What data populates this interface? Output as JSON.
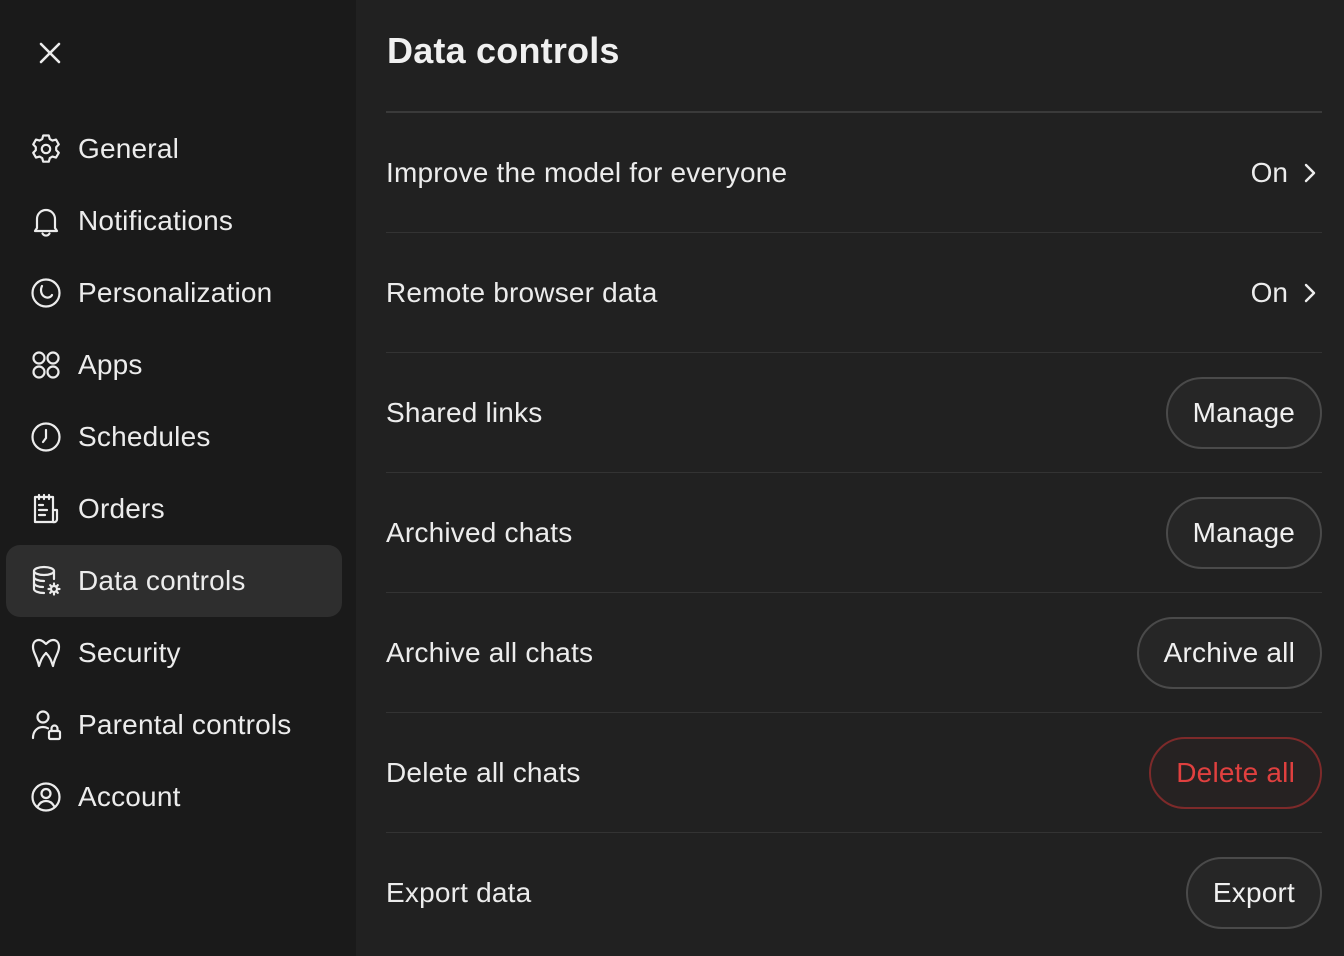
{
  "sidebar": {
    "close_icon": "close-icon",
    "items": [
      {
        "label": "General",
        "icon": "gear-icon"
      },
      {
        "label": "Notifications",
        "icon": "bell-icon"
      },
      {
        "label": "Personalization",
        "icon": "personalization-icon"
      },
      {
        "label": "Apps",
        "icon": "apps-grid-icon"
      },
      {
        "label": "Schedules",
        "icon": "clock-icon"
      },
      {
        "label": "Orders",
        "icon": "receipt-icon"
      },
      {
        "label": "Data controls",
        "icon": "database-gear-icon",
        "active": true
      },
      {
        "label": "Security",
        "icon": "shield-key-icon"
      },
      {
        "label": "Parental controls",
        "icon": "person-lock-icon"
      },
      {
        "label": "Account",
        "icon": "user-circle-icon"
      }
    ]
  },
  "main": {
    "title": "Data controls",
    "rows": [
      {
        "label": "Improve the model for everyone",
        "value": "On",
        "icon": "chevron-right-icon"
      },
      {
        "label": "Remote browser data",
        "value": "On",
        "icon": "chevron-right-icon"
      },
      {
        "label": "Shared links",
        "button": "Manage"
      },
      {
        "label": "Archived chats",
        "button": "Manage"
      },
      {
        "label": "Archive all chats",
        "button": "Archive all"
      },
      {
        "label": "Delete all chats",
        "button": "Delete all",
        "danger": true
      },
      {
        "label": "Export data",
        "button": "Export"
      }
    ]
  },
  "colors": {
    "background": "#212121",
    "sidebar": "#1a1a1a",
    "active_item": "#2e2e2e",
    "danger": "#e0403f"
  }
}
